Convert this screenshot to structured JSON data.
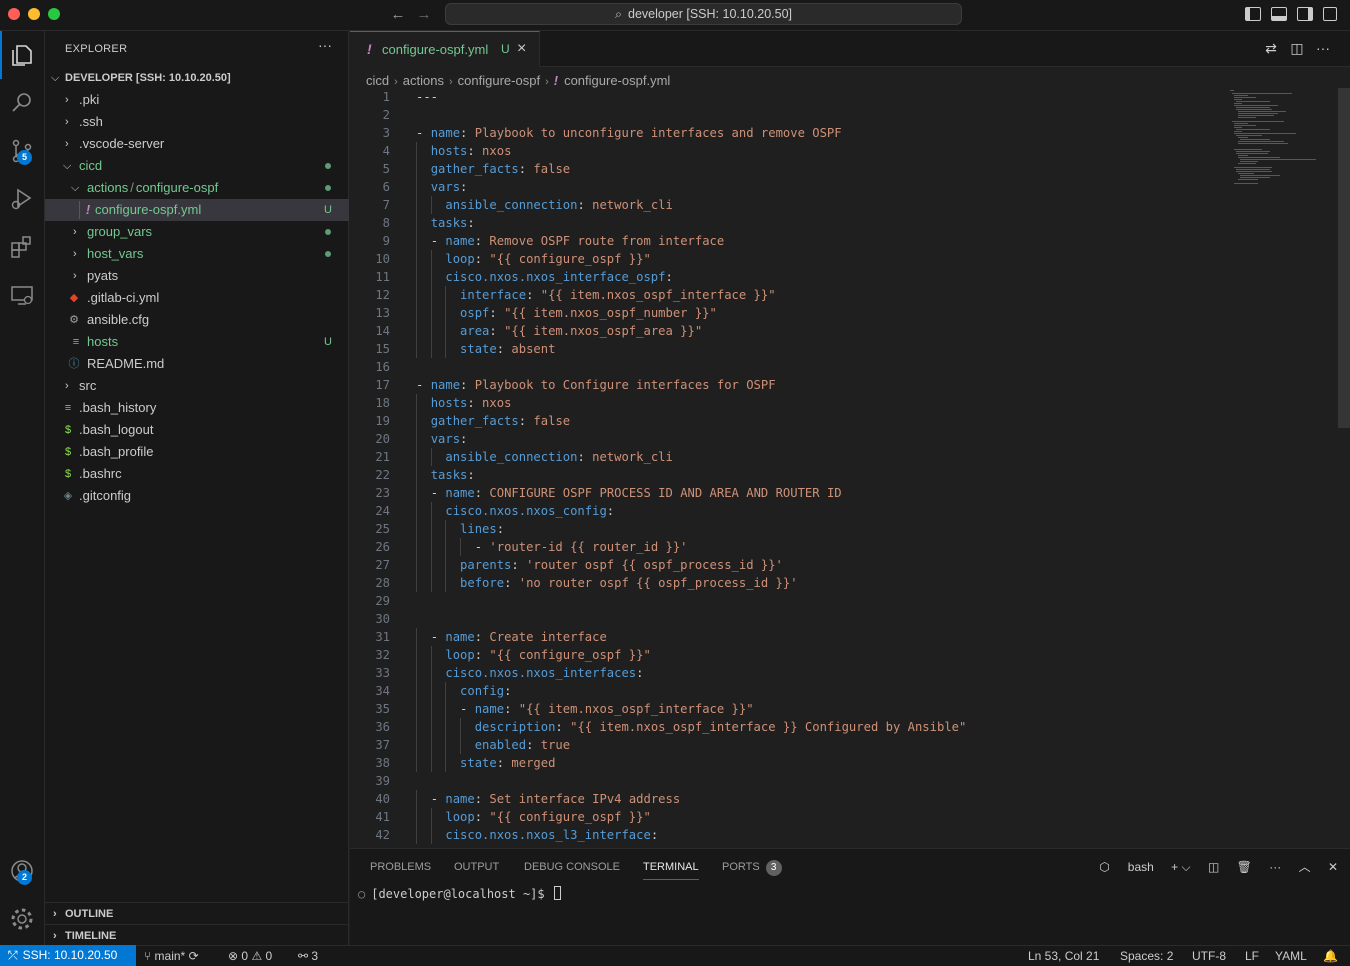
{
  "titlebar": {
    "command_center": "developer [SSH: 10.10.20.50]"
  },
  "activity": {
    "scm_badge": "5",
    "accounts_badge": "2"
  },
  "explorer": {
    "title": "EXPLORER",
    "more": "···",
    "root": "DEVELOPER [SSH: 10.10.20.50]",
    "items": [
      {
        "label": ".pki",
        "kind": "folder"
      },
      {
        "label": ".ssh",
        "kind": "folder"
      },
      {
        "label": ".vscode-server",
        "kind": "folder"
      },
      {
        "label": "cicd",
        "kind": "folder-open"
      },
      {
        "label_a": "actions",
        "label_sep": "/",
        "label_b": "configure-ospf",
        "kind": "folder-open"
      },
      {
        "label": "configure-ospf.yml",
        "kind": "yaml",
        "badge": "U"
      },
      {
        "label": "group_vars",
        "kind": "folder"
      },
      {
        "label": "host_vars",
        "kind": "folder"
      },
      {
        "label": "pyats",
        "kind": "folder"
      },
      {
        "label": ".gitlab-ci.yml",
        "kind": "gitlab"
      },
      {
        "label": "ansible.cfg",
        "kind": "gear"
      },
      {
        "label": "hosts",
        "kind": "lines",
        "badge": "U"
      },
      {
        "label": "README.md",
        "kind": "info"
      },
      {
        "label": "src",
        "kind": "folder"
      },
      {
        "label": ".bash_history",
        "kind": "lines"
      },
      {
        "label": ".bash_logout",
        "kind": "dollar"
      },
      {
        "label": ".bash_profile",
        "kind": "dollar"
      },
      {
        "label": ".bashrc",
        "kind": "dollar"
      },
      {
        "label": ".gitconfig",
        "kind": "diamond"
      }
    ],
    "outline": "OUTLINE",
    "timeline": "TIMELINE"
  },
  "editor": {
    "tab": {
      "icon": "!",
      "name": "configure-ospf.yml",
      "status": "U",
      "close": "×"
    },
    "breadcrumb": [
      "cicd",
      "actions",
      "configure-ospf",
      "configure-ospf.yml"
    ],
    "breadcrumb_icon": "!"
  },
  "code_lines": [
    {
      "n": "1",
      "t": "---"
    },
    {
      "n": "2",
      "t": ""
    },
    {
      "n": "3",
      "t": "- name: Playbook to unconfigure interfaces and remove OSPF"
    },
    {
      "n": "4",
      "t": "  hosts: nxos"
    },
    {
      "n": "5",
      "t": "  gather_facts: false"
    },
    {
      "n": "6",
      "t": "  vars:"
    },
    {
      "n": "7",
      "t": "    ansible_connection: network_cli"
    },
    {
      "n": "8",
      "t": "  tasks:"
    },
    {
      "n": "9",
      "t": "  - name: Remove OSPF route from interface"
    },
    {
      "n": "10",
      "t": "    loop: \"{{ configure_ospf }}\""
    },
    {
      "n": "11",
      "t": "    cisco.nxos.nxos_interface_ospf:"
    },
    {
      "n": "12",
      "t": "      interface: \"{{ item.nxos_ospf_interface }}\""
    },
    {
      "n": "13",
      "t": "      ospf: \"{{ item.nxos_ospf_number }}\""
    },
    {
      "n": "14",
      "t": "      area: \"{{ item.nxos_ospf_area }}\""
    },
    {
      "n": "15",
      "t": "      state: absent"
    },
    {
      "n": "16",
      "t": ""
    },
    {
      "n": "17",
      "t": "- name: Playbook to Configure interfaces for OSPF"
    },
    {
      "n": "18",
      "t": "  hosts: nxos"
    },
    {
      "n": "19",
      "t": "  gather_facts: false"
    },
    {
      "n": "20",
      "t": "  vars:"
    },
    {
      "n": "21",
      "t": "    ansible_connection: network_cli"
    },
    {
      "n": "22",
      "t": "  tasks:"
    },
    {
      "n": "23",
      "t": "  - name: CONFIGURE OSPF PROCESS ID AND AREA AND ROUTER ID"
    },
    {
      "n": "24",
      "t": "    cisco.nxos.nxos_config:"
    },
    {
      "n": "25",
      "t": "      lines:"
    },
    {
      "n": "26",
      "t": "        - 'router-id {{ router_id }}'"
    },
    {
      "n": "27",
      "t": "      parents: 'router ospf {{ ospf_process_id }}'"
    },
    {
      "n": "28",
      "t": "      before: 'no router ospf {{ ospf_process_id }}'"
    },
    {
      "n": "29",
      "t": ""
    },
    {
      "n": "30",
      "t": ""
    },
    {
      "n": "31",
      "t": "  - name: Create interface"
    },
    {
      "n": "32",
      "t": "    loop: \"{{ configure_ospf }}\""
    },
    {
      "n": "33",
      "t": "    cisco.nxos.nxos_interfaces:"
    },
    {
      "n": "34",
      "t": "      config:"
    },
    {
      "n": "35",
      "t": "      - name: \"{{ item.nxos_ospf_interface }}\""
    },
    {
      "n": "36",
      "t": "        description: \"{{ item.nxos_ospf_interface }} Configured by Ansible\""
    },
    {
      "n": "37",
      "t": "        enabled: true"
    },
    {
      "n": "38",
      "t": "      state: merged"
    },
    {
      "n": "39",
      "t": ""
    },
    {
      "n": "40",
      "t": "  - name: Set interface IPv4 address"
    },
    {
      "n": "41",
      "t": "    loop: \"{{ configure_ospf }}\""
    },
    {
      "n": "42",
      "t": "    cisco.nxos.nxos_l3_interface:"
    }
  ],
  "panel": {
    "tabs": [
      "PROBLEMS",
      "OUTPUT",
      "DEBUG CONSOLE",
      "TERMINAL",
      "PORTS"
    ],
    "ports_count": "3",
    "shell": "bash",
    "prompt": "[developer@localhost ~]$ "
  },
  "status": {
    "remote": "SSH: 10.10.20.50",
    "branch": "main*",
    "errors": "0",
    "warnings": "0",
    "ports": "3",
    "position": "Ln 53, Col 21",
    "spaces": "Spaces: 2",
    "encoding": "UTF-8",
    "eol": "LF",
    "language": "YAML"
  },
  "colors": {
    "accent": "#0078d4",
    "git_untracked": "#73c991",
    "yaml_key": "#569cd6",
    "yaml_string": "#ce9178"
  }
}
